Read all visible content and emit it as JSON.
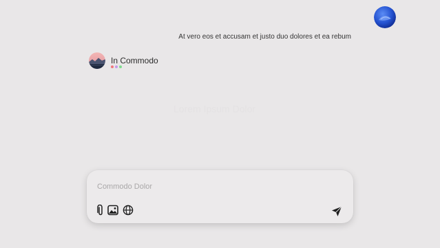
{
  "conversation": {
    "user_message": "At vero eos et accusam et justo duo dolores et ea rebum",
    "assistant_name": "In Commodo",
    "ghost_text": "Lorem Ipsum Dolor",
    "typing_dot_colors": [
      "#f0777c",
      "#c49be8",
      "#7fdc8e"
    ]
  },
  "composer": {
    "placeholder": "Commodo Dolor",
    "value": "",
    "tools": [
      {
        "icon": "paperclip-icon",
        "action": "attach"
      },
      {
        "icon": "image-icon",
        "action": "image"
      },
      {
        "icon": "globe-icon",
        "action": "web"
      }
    ],
    "send_icon": "send-icon"
  },
  "colors": {
    "background": "#e9e7e8",
    "user_avatar": "#2c5fd6"
  }
}
